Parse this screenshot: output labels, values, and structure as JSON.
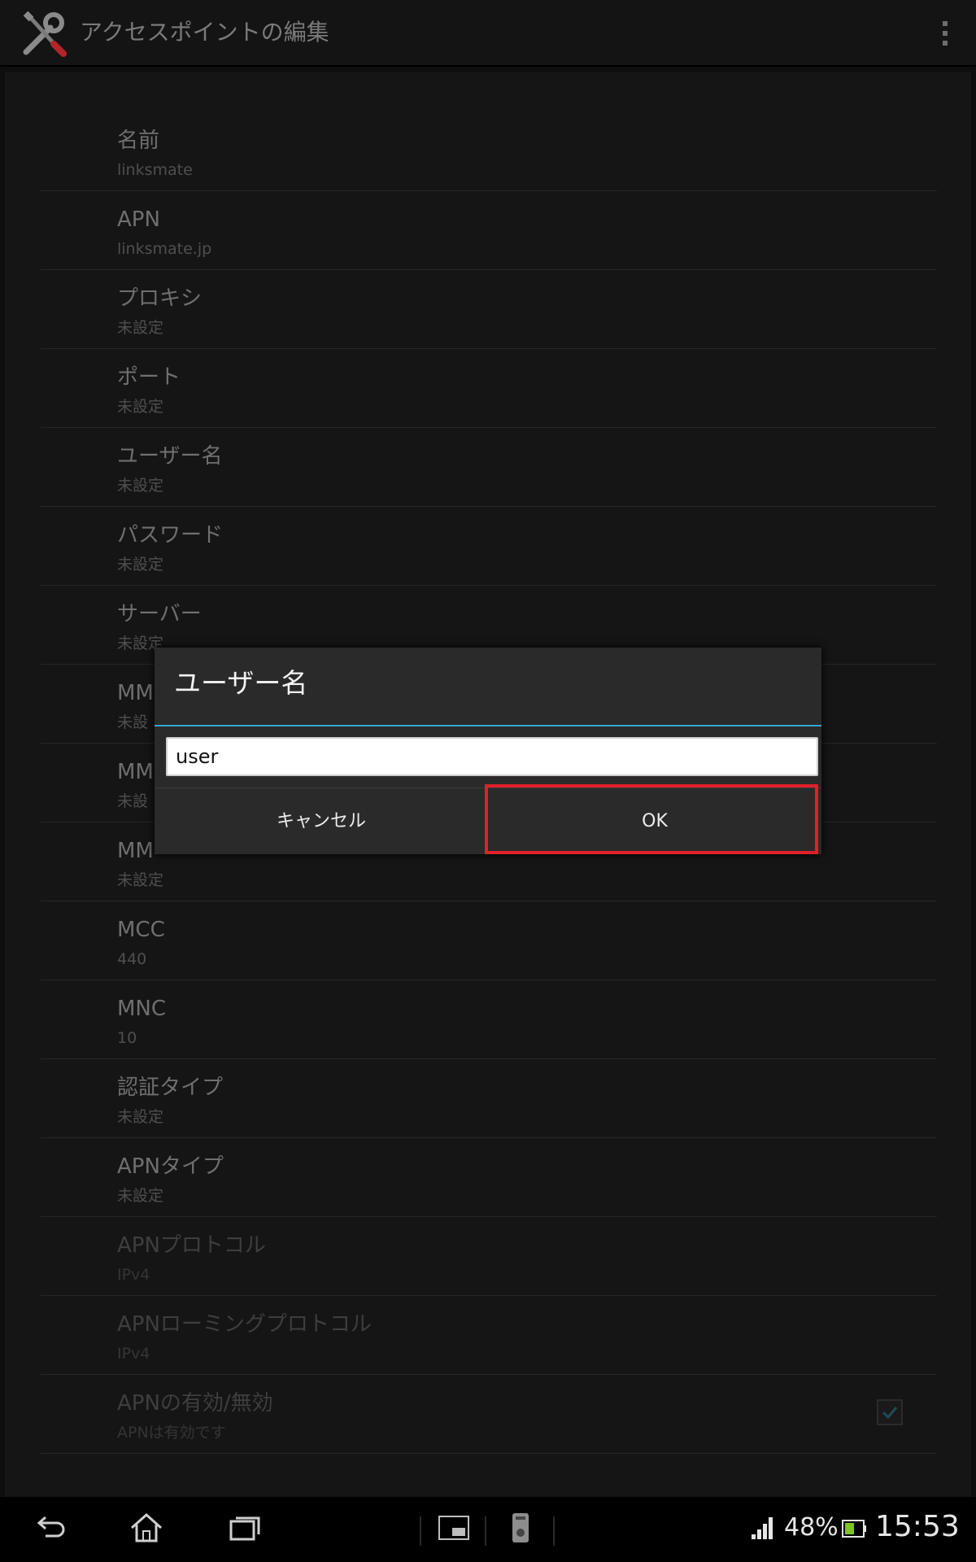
{
  "action_bar": {
    "title": "アクセスポイントの編集",
    "app_icon": "tools-icon",
    "menu_icon": "overflow-menu-icon"
  },
  "preferences": [
    {
      "title": "名前",
      "summary": "linksmate"
    },
    {
      "title": "APN",
      "summary": "linksmate.jp"
    },
    {
      "title": "プロキシ",
      "summary": "未設定"
    },
    {
      "title": "ポート",
      "summary": "未設定"
    },
    {
      "title": "ユーザー名",
      "summary": "未設定"
    },
    {
      "title": "パスワード",
      "summary": "未設定"
    },
    {
      "title": "サーバー",
      "summary": "未設定"
    },
    {
      "title": "MM",
      "summary": "未設"
    },
    {
      "title": "MM",
      "summary": "未設"
    },
    {
      "title": "MM",
      "summary": "未設定"
    },
    {
      "title": "MCC",
      "summary": "440"
    },
    {
      "title": "MNC",
      "summary": "10"
    },
    {
      "title": "認証タイプ",
      "summary": "未設定"
    },
    {
      "title": "APNタイプ",
      "summary": "未設定"
    },
    {
      "title": "APNプロトコル",
      "summary": "IPv4"
    },
    {
      "title": "APNローミングプロトコル",
      "summary": "IPv4"
    },
    {
      "title": "APNの有効/無効",
      "summary": "APNは有効です",
      "checked": true
    }
  ],
  "dialog": {
    "title": "ユーザー名",
    "input_value": "user",
    "cancel_label": "キャンセル",
    "ok_label": "OK"
  },
  "status_bar": {
    "battery": "48%",
    "time": "15:53"
  },
  "colors": {
    "accent": "#32a7d3",
    "highlight": "#e0202a"
  }
}
